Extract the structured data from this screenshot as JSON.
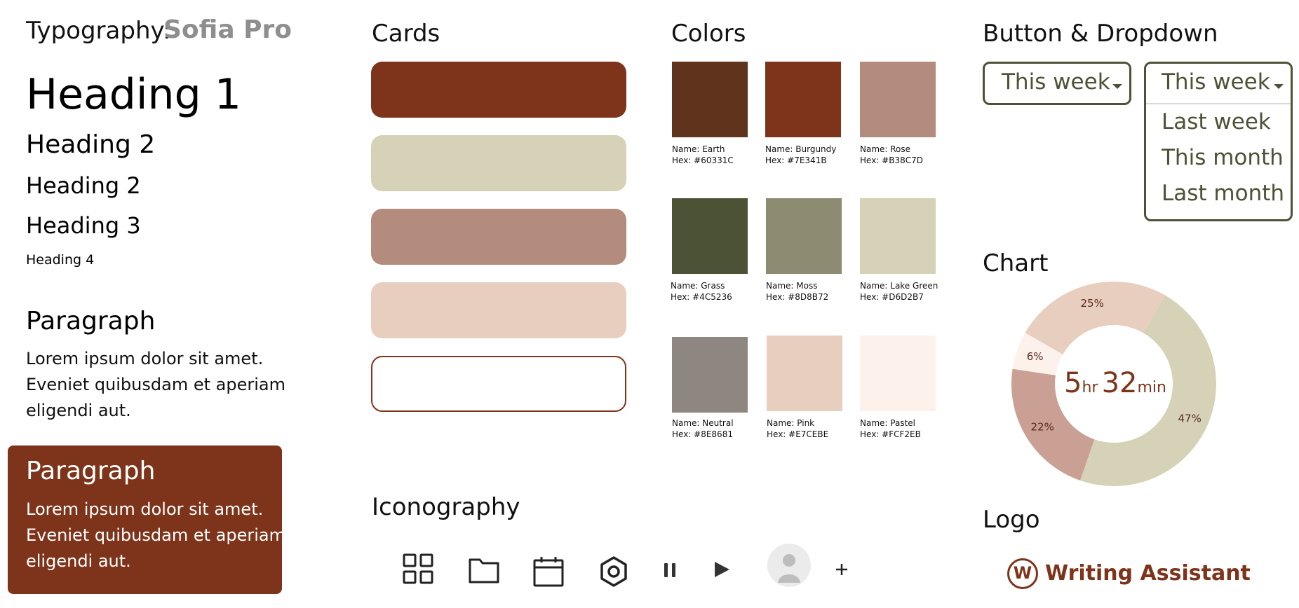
{
  "typography": {
    "label": "Typography:",
    "font_name": "Sofia Pro",
    "heading1": "Heading 1",
    "heading2a": "Heading 2",
    "heading2b": "Heading 2",
    "heading3": "Heading 3",
    "heading4": "Heading 4",
    "paragraph_title": "Paragraph",
    "paragraph_text": "Lorem ipsum dolor sit amet. Eveniet quibusdam et aperiam eligendi aut.",
    "paragraph_box_title": "Paragraph",
    "paragraph_box_text": "Lorem ipsum dolor sit amet. Eveniet quibusdam et aperiam eligendi aut."
  },
  "cards": {
    "title": "Cards",
    "colors": [
      "#7E341B",
      "#D6D2B7",
      "#B38C7D",
      "#E7CEBE"
    ],
    "outline_color": "#7E341B"
  },
  "colors": {
    "title": "Colors",
    "swatches": [
      {
        "name": "Name: Earth",
        "hex": "Hex: #60331C",
        "value": "#60331C"
      },
      {
        "name": "Name: Burgundy",
        "hex": "Hex: #7E341B",
        "value": "#7E341B"
      },
      {
        "name": "Name: Rose",
        "hex": "Hex: #B38C7D",
        "value": "#B38C7D"
      },
      {
        "name": "Name: Grass",
        "hex": "Hex: #4C5236",
        "value": "#4C5236"
      },
      {
        "name": "Name: Moss",
        "hex": "Hex: #8D8B72",
        "value": "#8D8B72"
      },
      {
        "name": "Name: Lake Green",
        "hex": "Hex: #D6D2B7",
        "value": "#D6D2B7"
      },
      {
        "name": "Name: Neutral",
        "hex": "Hex: #8E8681",
        "value": "#8E8681"
      },
      {
        "name": "Name: Pink",
        "hex": "Hex: #E7CEBE",
        "value": "#E7CEBE"
      },
      {
        "name": "Name: Pastel",
        "hex": "Hex: #FCF2EB",
        "value": "#FCF2EB"
      }
    ]
  },
  "button_dropdown": {
    "title": "Button & Dropdown",
    "button_value": "This week",
    "dropdown_value": "This week",
    "options": [
      "Last week",
      "This month",
      "Last month"
    ]
  },
  "chart": {
    "title": "Chart",
    "center_hours": "5",
    "center_hours_unit": "hr",
    "center_minutes": "32",
    "center_minutes_unit": "min"
  },
  "chart_data": {
    "type": "pie",
    "categories": [
      "47%",
      "22%",
      "6%",
      "25%"
    ],
    "values": [
      47,
      22,
      6,
      25
    ],
    "colors": [
      "#D6D2B7",
      "#C9A093",
      "#FCF2EB",
      "#E7CEBE"
    ],
    "labels": [
      "47%",
      "22%",
      "6%",
      "25%"
    ]
  },
  "iconography": {
    "title": "Iconography",
    "icons": [
      "grid-icon",
      "folder-icon",
      "calendar-icon",
      "settings-icon",
      "pause-icon",
      "play-icon",
      "avatar-icon",
      "plus-icon"
    ]
  },
  "logo": {
    "title": "Logo",
    "mark": "W",
    "text": "Writing Assistant",
    "color": "#7E341B"
  }
}
